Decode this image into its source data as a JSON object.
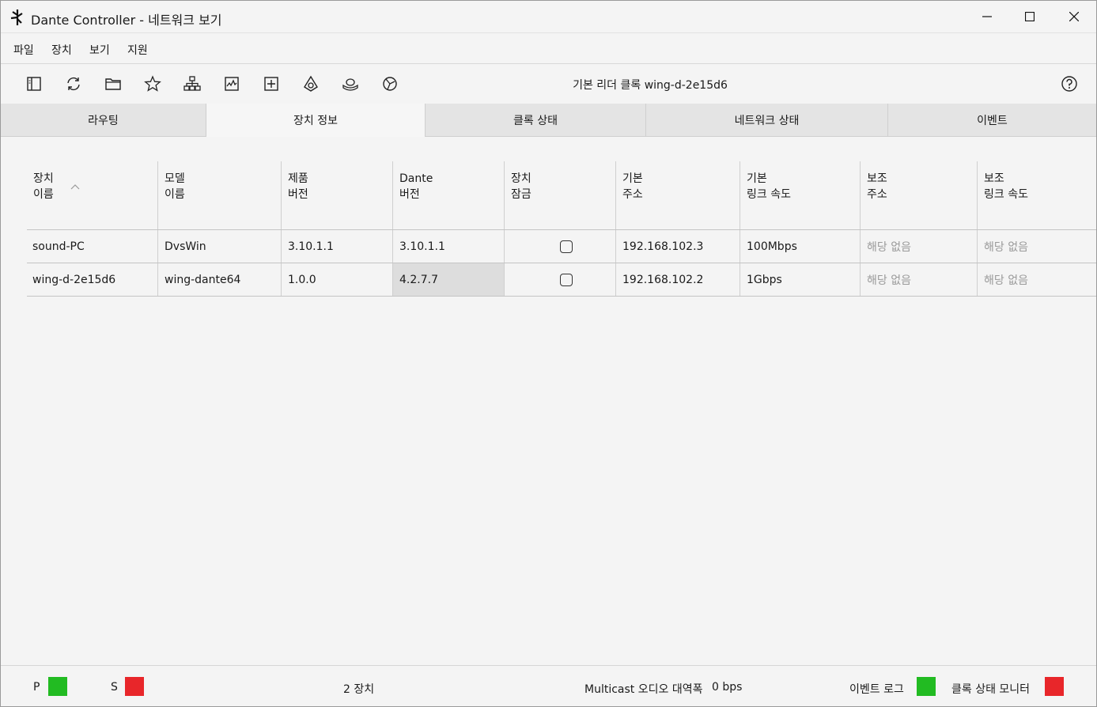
{
  "window": {
    "title": "Dante Controller - 네트워크 보기",
    "controls": [
      "minimize-icon",
      "maximize-icon",
      "close-icon"
    ]
  },
  "menu": [
    "파일",
    "장치",
    "보기",
    "지원"
  ],
  "toolbar": {
    "icons": [
      "sidebar-icon",
      "refresh-icon",
      "folder-icon",
      "star-icon",
      "network-tree-icon",
      "monitor-icon",
      "add-icon",
      "dante-diamond-icon",
      "clock-stack-icon",
      "domain-globe-icon"
    ],
    "leader_clock": "기본 리더 클록 wing-d-2e15d6",
    "help_icon": "help-icon"
  },
  "tabs": [
    {
      "label": "라우팅",
      "active": false
    },
    {
      "label": "장치 정보",
      "active": true
    },
    {
      "label": "클록 상태",
      "active": false
    },
    {
      "label": "네트워크 상태",
      "active": false
    },
    {
      "label": "이벤트",
      "active": false
    }
  ],
  "table": {
    "columns": [
      {
        "line1": "장치",
        "line2": "이름",
        "sorted": "ascending"
      },
      {
        "line1": "모델",
        "line2": "이름"
      },
      {
        "line1": "제품",
        "line2": "버전"
      },
      {
        "line1": "Dante",
        "line2": "버전"
      },
      {
        "line1": "장치",
        "line2": "잠금"
      },
      {
        "line1": "기본",
        "line2": "주소"
      },
      {
        "line1": "기본",
        "line2": "링크 속도"
      },
      {
        "line1": "보조",
        "line2": "주소"
      },
      {
        "line1": "보조",
        "line2": "링크 속도"
      }
    ],
    "rows": [
      {
        "name": "sound-PC",
        "model": "DvsWin",
        "product_version": "3.10.1.1",
        "dante_version": "3.10.1.1",
        "locked": false,
        "primary_address": "192.168.102.3",
        "primary_link_speed": "100Mbps",
        "secondary_address": "해당 없음",
        "secondary_link_speed": "해당 없음"
      },
      {
        "name": "wing-d-2e15d6",
        "model": "wing-dante64",
        "product_version": "1.0.0",
        "dante_version": "4.2.7.7",
        "locked": false,
        "primary_address": "192.168.102.2",
        "primary_link_speed": "1Gbps",
        "secondary_address": "해당 없음",
        "secondary_link_speed": "해당 없음"
      }
    ]
  },
  "status": {
    "primary_label": "P",
    "primary_color": "#22bb22",
    "secondary_label": "S",
    "secondary_color": "#e8262a",
    "device_count": "2 장치",
    "multicast_label": "Multicast 오디오 대역폭",
    "multicast_value": "0 bps",
    "event_log_label": "이벤트 로그",
    "event_log_color": "#22bb22",
    "clock_monitor_label": "클록 상태 모니터",
    "clock_monitor_color": "#e8262a"
  }
}
